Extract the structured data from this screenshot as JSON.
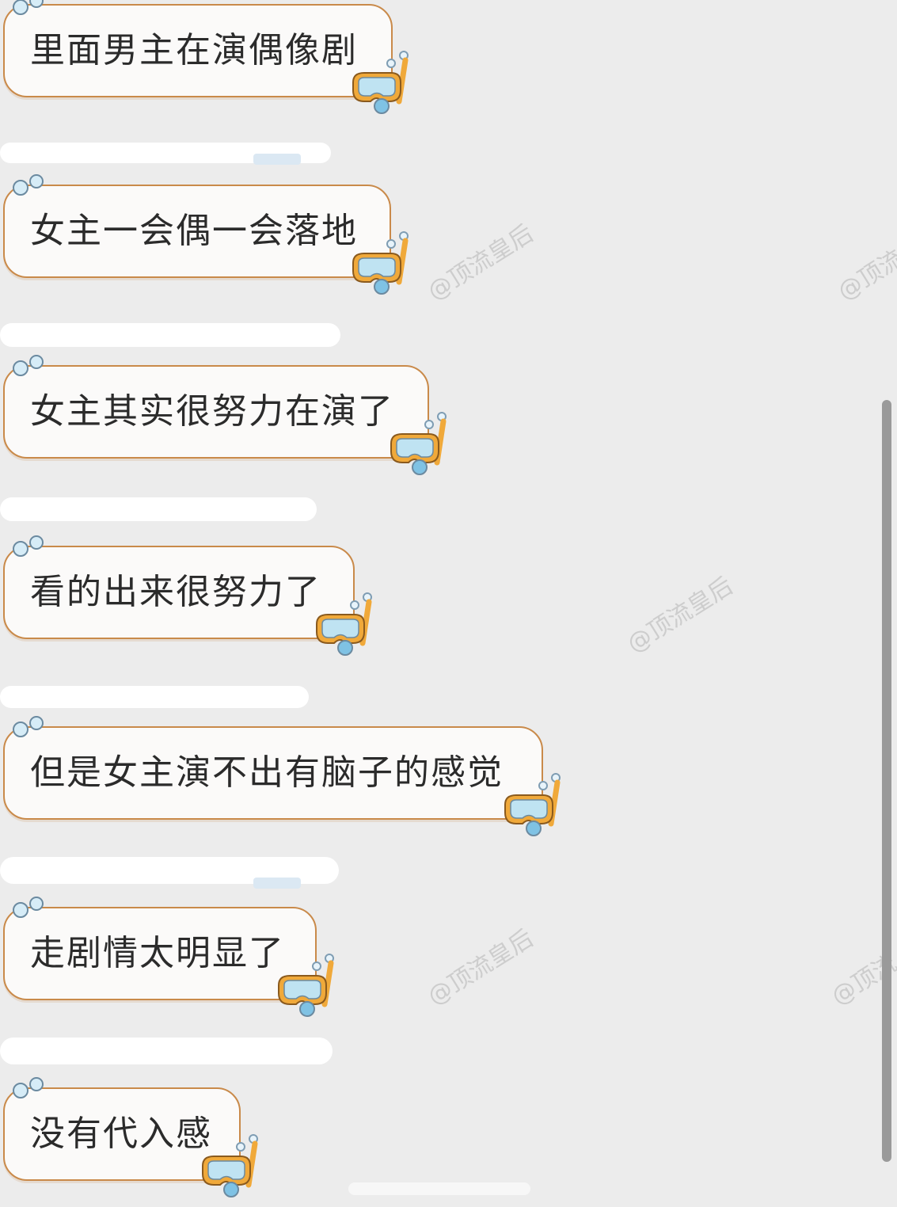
{
  "messages": [
    {
      "text": "里面男主在演偶像剧"
    },
    {
      "text": "女主一会偶一会落地"
    },
    {
      "text": "女主其实很努力在演了"
    },
    {
      "text": "看的出来很努力了"
    },
    {
      "text": "但是女主演不出有脑子的感觉"
    },
    {
      "text": "走剧情太明显了"
    },
    {
      "text": "没有代入感"
    }
  ],
  "watermarks": [
    {
      "text": "@顶流皇后"
    },
    {
      "text": "@顶流"
    },
    {
      "text": "@顶流皇后"
    },
    {
      "text": "@顶流皇后"
    },
    {
      "text": "@顶流"
    }
  ],
  "icons": {
    "bubble_decoration": "bubbles-icon",
    "bubble_corner": "diving-goggles-icon"
  },
  "colors": {
    "background": "#ececec",
    "bubble_fill": "#fbfaf9",
    "bubble_border": "#c98a4a",
    "text": "#2b2b2b",
    "goggle_frame": "#f0a93a",
    "goggle_lens": "#bfe3f2"
  }
}
